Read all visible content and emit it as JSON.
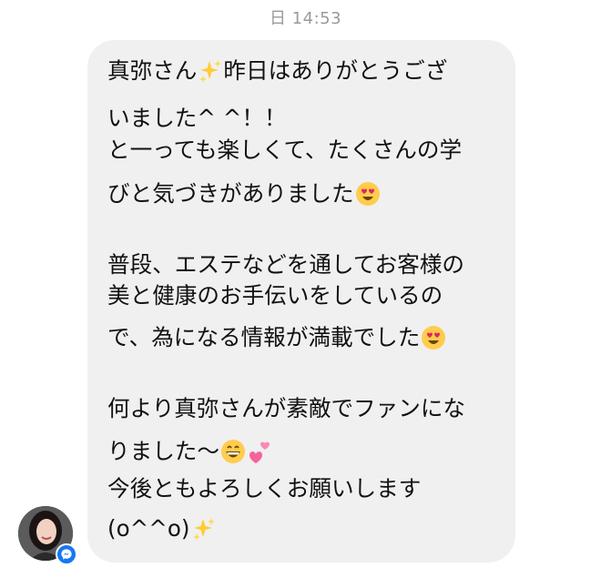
{
  "timestamp": "日 14:53",
  "message": {
    "lines": [
      {
        "text": "真弥さん",
        "emoji": "sparkles-icon",
        "tail": "昨日はありがとうござ"
      },
      {
        "text": "いました^ ^！！"
      },
      {
        "text": "と一っても楽しくて、たくさんの学"
      },
      {
        "text": "びと気づきがありました",
        "emoji": "heart-eyes-emoji-icon"
      },
      {
        "text": "普段、エステなどを通してお客様の"
      },
      {
        "text": "美と健康のお手伝いをしているの"
      },
      {
        "text": "で、為になる情報が満載でした",
        "emoji": "heart-eyes-emoji-icon"
      },
      {
        "text": "何より真弥さんが素敵でファンにな"
      },
      {
        "text": "りました〜",
        "emoji": "grinning-emoji-icon",
        "emoji2": "two-hearts-icon"
      },
      {
        "text": "今後ともよろしくお願いします"
      },
      {
        "text": "(o^^o)",
        "emoji": "sparkles-icon"
      }
    ]
  },
  "colors": {
    "bubble_bg": "#f0f0f0",
    "timestamp_text": "#9a9a9a",
    "messenger_badge": "#1877f2"
  }
}
